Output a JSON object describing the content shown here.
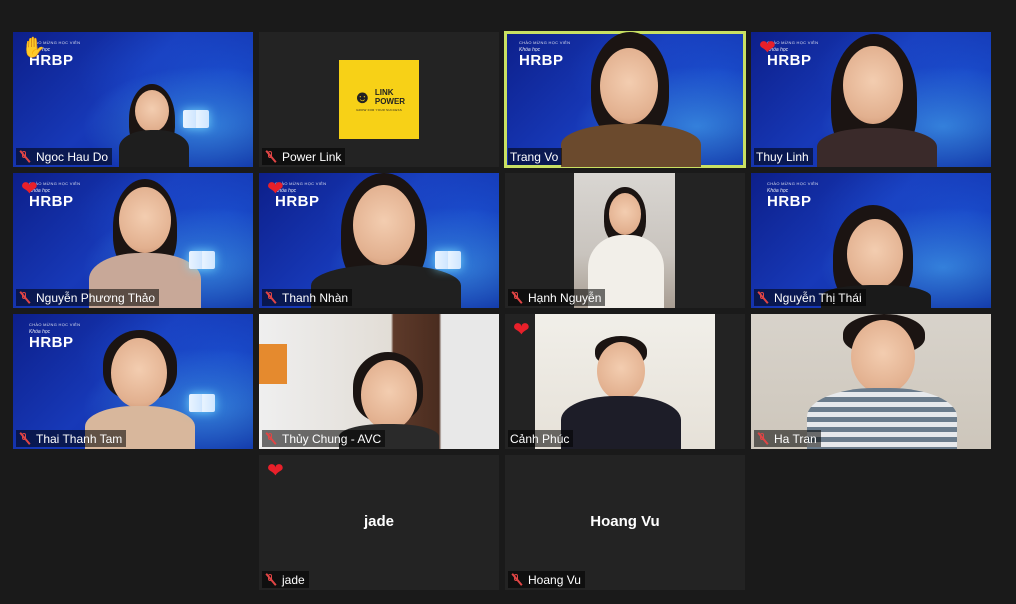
{
  "brand": {
    "small_text": "CHÀO MỪNG HỌC VIÊN",
    "course_label": "Khóa học",
    "course_name": "HRBP",
    "cohort": "Online 08"
  },
  "logo": {
    "line1": "LINK",
    "line2": "POWER",
    "tagline": "GROW FOR YOUR SUCCESS"
  },
  "participants": [
    {
      "name": "Ngoc Hau Do",
      "muted": true,
      "reaction": "raised-hand"
    },
    {
      "name": "Power Link",
      "muted": true,
      "reaction": ""
    },
    {
      "name": "Trang Vo",
      "muted": false,
      "reaction": "",
      "active_speaker": true
    },
    {
      "name": "Thuy Linh",
      "muted": false,
      "reaction": "heart"
    },
    {
      "name": "Nguyễn Phương Thảo",
      "muted": true,
      "reaction": "heart"
    },
    {
      "name": "Thanh Nhàn",
      "muted": true,
      "reaction": "heart"
    },
    {
      "name": "Hạnh Nguyễn",
      "muted": true,
      "reaction": ""
    },
    {
      "name": "Nguyễn Thị Thái",
      "muted": true,
      "reaction": ""
    },
    {
      "name": "Thai Thanh Tam",
      "muted": true,
      "reaction": ""
    },
    {
      "name": "Thủy Chung - AVC",
      "muted": true,
      "reaction": ""
    },
    {
      "name": "Cảnh Phúc",
      "muted": false,
      "reaction": "heart"
    },
    {
      "name": "Ha Tran",
      "muted": true,
      "reaction": ""
    },
    {
      "name": "jade",
      "muted": true,
      "reaction": "heart",
      "display_name": "jade"
    },
    {
      "name": "Hoang Vu",
      "muted": true,
      "reaction": "",
      "display_name": "Hoang Vu"
    }
  ],
  "colors": {
    "active_border": "#c9e063",
    "muted_icon": "#e04545",
    "heart": "#e8202a",
    "background": "#1a1a1a"
  },
  "icons": {
    "muted": "mic-muted-icon",
    "heart": "heart-icon",
    "raised_hand": "raised-hand-icon"
  },
  "reaction_glyphs": {
    "heart": "❤",
    "raised_hand": "✋"
  }
}
